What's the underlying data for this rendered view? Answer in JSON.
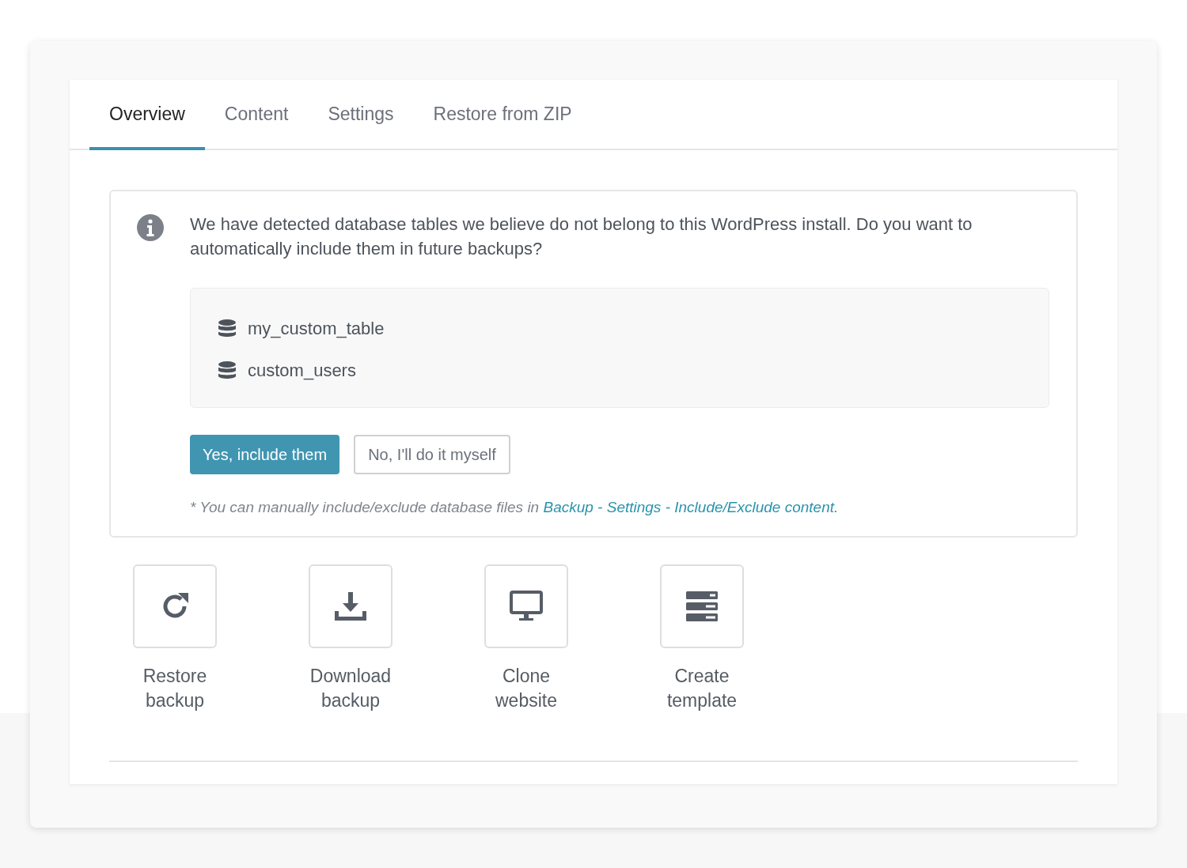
{
  "tabs": [
    {
      "label": "Overview",
      "selected": true
    },
    {
      "label": "Content",
      "selected": false
    },
    {
      "label": "Settings",
      "selected": false
    },
    {
      "label": "Restore from ZIP",
      "selected": false
    }
  ],
  "notice": {
    "message": "We have detected database tables we believe do not belong to this WordPress install. Do you want to automatically include them in future backups?",
    "tables": [
      "my_custom_table",
      "custom_users"
    ],
    "buttons": [
      {
        "label": "Yes, include them",
        "kind": "primary"
      },
      {
        "label": "No, I'll do it myself",
        "kind": "secondary"
      }
    ],
    "note": {
      "text": "* You can manually include/exclude database files in",
      "link": "Backup - Settings - Include/Exclude content."
    }
  },
  "actions": [
    {
      "label": "Restore backup",
      "kind": "restore"
    },
    {
      "label": "Download backup",
      "kind": "download"
    },
    {
      "label": "Clone website",
      "kind": "clone"
    },
    {
      "label": "Create template",
      "kind": "template"
    }
  ]
}
